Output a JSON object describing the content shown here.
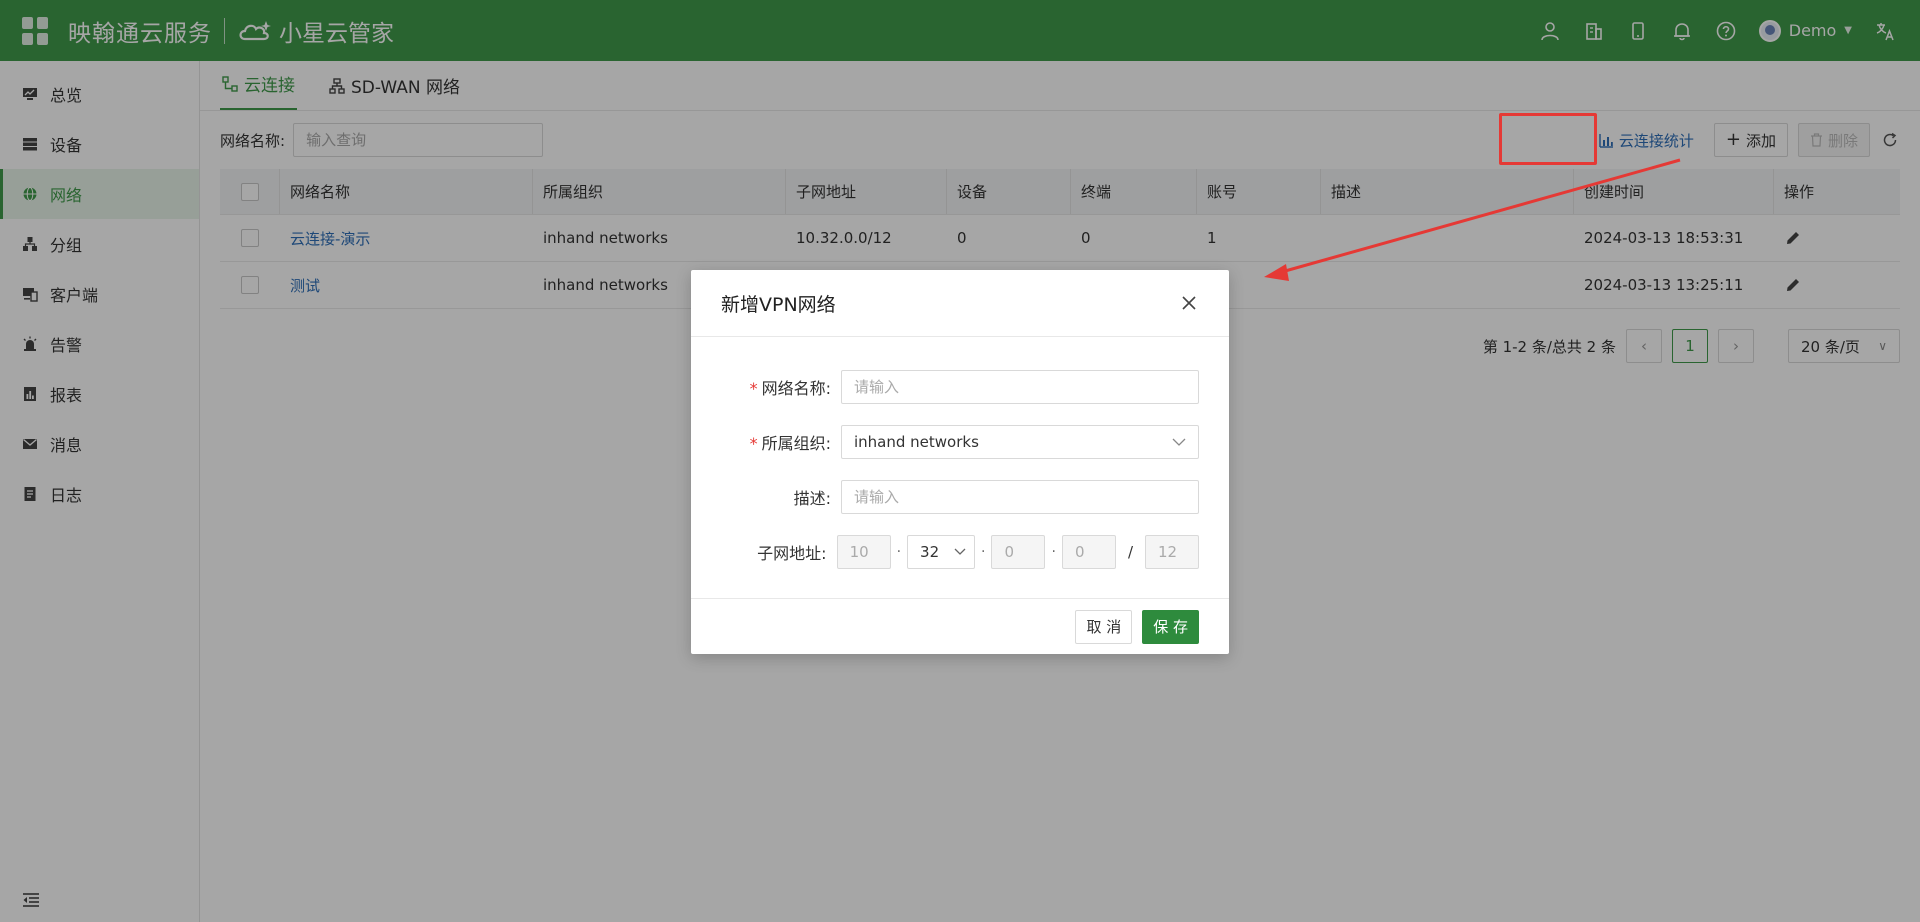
{
  "header": {
    "brand": "映翰通云服务",
    "brand2": "小星云管家",
    "user": "Demo",
    "icons": [
      "user-icon",
      "building-icon",
      "mobile-icon",
      "bell-icon",
      "help-icon",
      "translate-icon"
    ]
  },
  "sidebar": {
    "items": [
      {
        "label": "总览",
        "icon": "monitor-icon"
      },
      {
        "label": "设备",
        "icon": "server-icon"
      },
      {
        "label": "网络",
        "icon": "globe-icon",
        "active": true
      },
      {
        "label": "分组",
        "icon": "group-icon"
      },
      {
        "label": "客户端",
        "icon": "client-icon"
      },
      {
        "label": "告警",
        "icon": "alarm-icon"
      },
      {
        "label": "报表",
        "icon": "report-icon"
      },
      {
        "label": "消息",
        "icon": "mail-icon"
      },
      {
        "label": "日志",
        "icon": "log-icon"
      }
    ]
  },
  "tabs": [
    {
      "label": "云连接",
      "active": true
    },
    {
      "label": "SD-WAN 网络"
    }
  ],
  "toolbar": {
    "search_label": "网络名称:",
    "search_placeholder": "输入查询",
    "stat_link": "云连接统计",
    "add_label": "添加",
    "delete_label": "删除"
  },
  "table": {
    "columns": [
      "网络名称",
      "所属组织",
      "子网地址",
      "设备",
      "终端",
      "账号",
      "描述",
      "创建时间",
      "操作"
    ],
    "rows": [
      {
        "name": "云连接-演示",
        "org": "inhand networks",
        "subnet": "10.32.0.0/12",
        "devices": "0",
        "terminals": "0",
        "accounts": "1",
        "desc": "",
        "created": "2024-03-13 18:53:31"
      },
      {
        "name": "测试",
        "org": "inhand networks",
        "subnet": "",
        "devices": "",
        "terminals": "",
        "accounts": "",
        "desc": "",
        "created": "2024-03-13 13:25:11"
      }
    ]
  },
  "pager": {
    "summary": "第 1-2 条/总共 2 条",
    "current": "1",
    "page_size": "20 条/页"
  },
  "modal": {
    "title": "新增VPN网络",
    "fields": {
      "name_label": "网络名称:",
      "name_placeholder": "请输入",
      "org_label": "所属组织:",
      "org_value": "inhand networks",
      "desc_label": "描述:",
      "desc_placeholder": "请输入",
      "subnet_label": "子网地址:",
      "subnet_o1": "10",
      "subnet_o2": "32",
      "subnet_o3": "0",
      "subnet_o4": "0",
      "subnet_mask": "12"
    },
    "cancel_label": "取 消",
    "save_label": "保 存"
  },
  "colors": {
    "brand_green": "#3f9a4a",
    "primary_button": "#2e8b3d",
    "link_blue": "#2f6fb8",
    "annotation_red": "#e53935"
  }
}
